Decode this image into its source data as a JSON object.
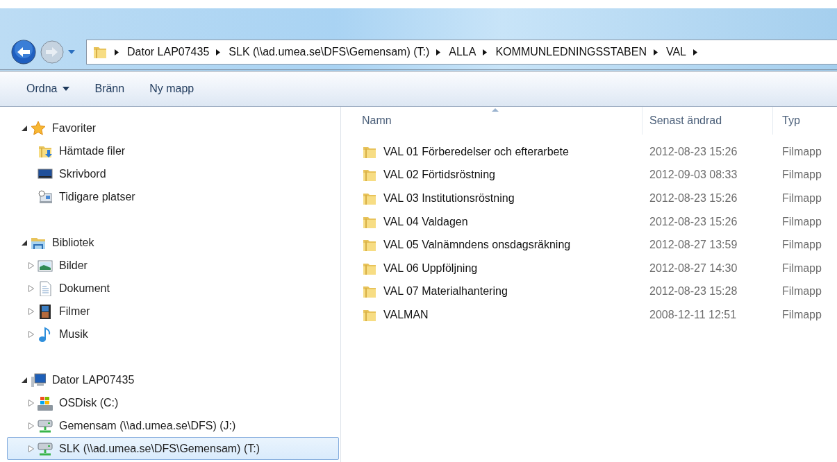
{
  "address_bar": {
    "segments": [
      "Dator LAP07435",
      "SLK (\\\\ad.umea.se\\DFS\\Gemensam) (T:)",
      "ALLA",
      "KOMMUNLEDNINGSSTABEN",
      "VAL"
    ]
  },
  "toolbar": {
    "buttons": [
      {
        "label": "Ordna",
        "dropdown": true
      },
      {
        "label": "Bränn",
        "dropdown": false
      },
      {
        "label": "Ny mapp",
        "dropdown": false
      }
    ]
  },
  "navigation": {
    "groups": [
      {
        "label": "Favoriter",
        "kind": "star",
        "expanded": true,
        "selected": false,
        "children": [
          {
            "label": "Hämtade filer",
            "kind": "downloads",
            "selected": false
          },
          {
            "label": "Skrivbord",
            "kind": "desktop",
            "selected": false
          },
          {
            "label": "Tidigare platser",
            "kind": "recent",
            "selected": false
          }
        ]
      },
      {
        "label": "Bibliotek",
        "kind": "library",
        "expanded": true,
        "selected": false,
        "children": [
          {
            "label": "Bilder",
            "kind": "pictures",
            "expanded": false,
            "selected": false
          },
          {
            "label": "Dokument",
            "kind": "documents",
            "expanded": false,
            "selected": false
          },
          {
            "label": "Filmer",
            "kind": "videos",
            "expanded": false,
            "selected": false
          },
          {
            "label": "Musik",
            "kind": "music",
            "expanded": false,
            "selected": false
          }
        ]
      },
      {
        "label": "Dator LAP07435",
        "kind": "computer",
        "expanded": true,
        "selected": false,
        "children": [
          {
            "label": "OSDisk (C:)",
            "kind": "disk",
            "expanded": false,
            "selected": false
          },
          {
            "label": "Gemensam (\\\\ad.umea.se\\DFS) (J:)",
            "kind": "network",
            "expanded": false,
            "selected": false
          },
          {
            "label": "SLK (\\\\ad.umea.se\\DFS\\Gemensam) (T:)",
            "kind": "network",
            "expanded": false,
            "selected": true
          }
        ]
      }
    ]
  },
  "file_list": {
    "columns": [
      {
        "label": "Namn",
        "sorted": true
      },
      {
        "label": "Senast ändrad",
        "sorted": false
      },
      {
        "label": "Typ",
        "sorted": false
      }
    ],
    "rows": [
      {
        "name": "VAL 01 Förberedelser och efterarbete",
        "modified": "2012-08-23 15:26",
        "type": "Filmapp"
      },
      {
        "name": "VAL 02 Förtidsröstning",
        "modified": "2012-09-03 08:33",
        "type": "Filmapp"
      },
      {
        "name": "VAL 03 Institutionsröstning",
        "modified": "2012-08-23 15:26",
        "type": "Filmapp"
      },
      {
        "name": "VAL 04 Valdagen",
        "modified": "2012-08-23 15:26",
        "type": "Filmapp"
      },
      {
        "name": "VAL 05 Valnämndens onsdagsräkning",
        "modified": "2012-08-27 13:59",
        "type": "Filmapp"
      },
      {
        "name": "VAL 06 Uppföljning",
        "modified": "2012-08-27 14:30",
        "type": "Filmapp"
      },
      {
        "name": "VAL 07 Materialhantering",
        "modified": "2012-08-23 15:28",
        "type": "Filmapp"
      },
      {
        "name": "VALMAN",
        "modified": "2008-12-11 12:51",
        "type": "Filmapp"
      }
    ]
  }
}
